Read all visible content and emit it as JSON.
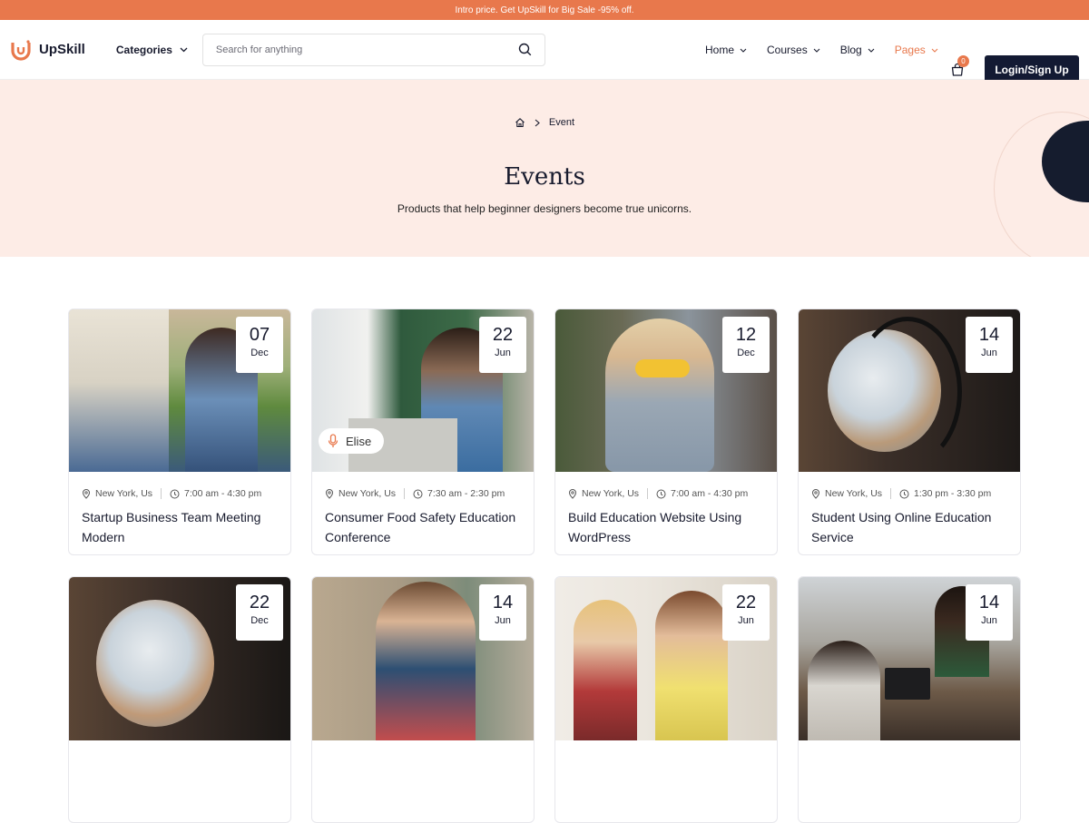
{
  "promo": {
    "text": "Intro price. Get UpSkill for Big Sale -95% off."
  },
  "brand": {
    "name": "UpSkill",
    "accent": "#e8784c",
    "dark": "#131a33"
  },
  "nav": {
    "categories_label": "Categories",
    "search_placeholder": "Search for anything",
    "menu": [
      {
        "label": "Home"
      },
      {
        "label": "Courses"
      },
      {
        "label": "Blog"
      },
      {
        "label": "Pages",
        "active": true
      }
    ],
    "cart_count": "0",
    "login_label": "Login/Sign Up"
  },
  "hero": {
    "breadcrumb_current": "Event",
    "title": "Events",
    "subtitle": "Products that help beginner designers become true unicorns."
  },
  "events": [
    {
      "day": "07",
      "month": "Dec",
      "location": "New York, Us",
      "time": "7:00 am - 4:30 pm",
      "title": "Startup Business Team Meeting Modern"
    },
    {
      "day": "22",
      "month": "Jun",
      "location": "New York, Us",
      "time": "7:30 am - 2:30 pm",
      "title": "Consumer Food Safety Education Conference",
      "speaker": "Elise"
    },
    {
      "day": "12",
      "month": "Dec",
      "location": "New York, Us",
      "time": "7:00 am - 4:30 pm",
      "title": "Build Education Website Using WordPress"
    },
    {
      "day": "14",
      "month": "Jun",
      "location": "New York, Us",
      "time": "1:30 pm - 3:30 pm",
      "title": "Student Using Online Education Service"
    },
    {
      "day": "22",
      "month": "Dec"
    },
    {
      "day": "14",
      "month": "Jun"
    },
    {
      "day": "22",
      "month": "Jun"
    },
    {
      "day": "14",
      "month": "Jun"
    }
  ]
}
